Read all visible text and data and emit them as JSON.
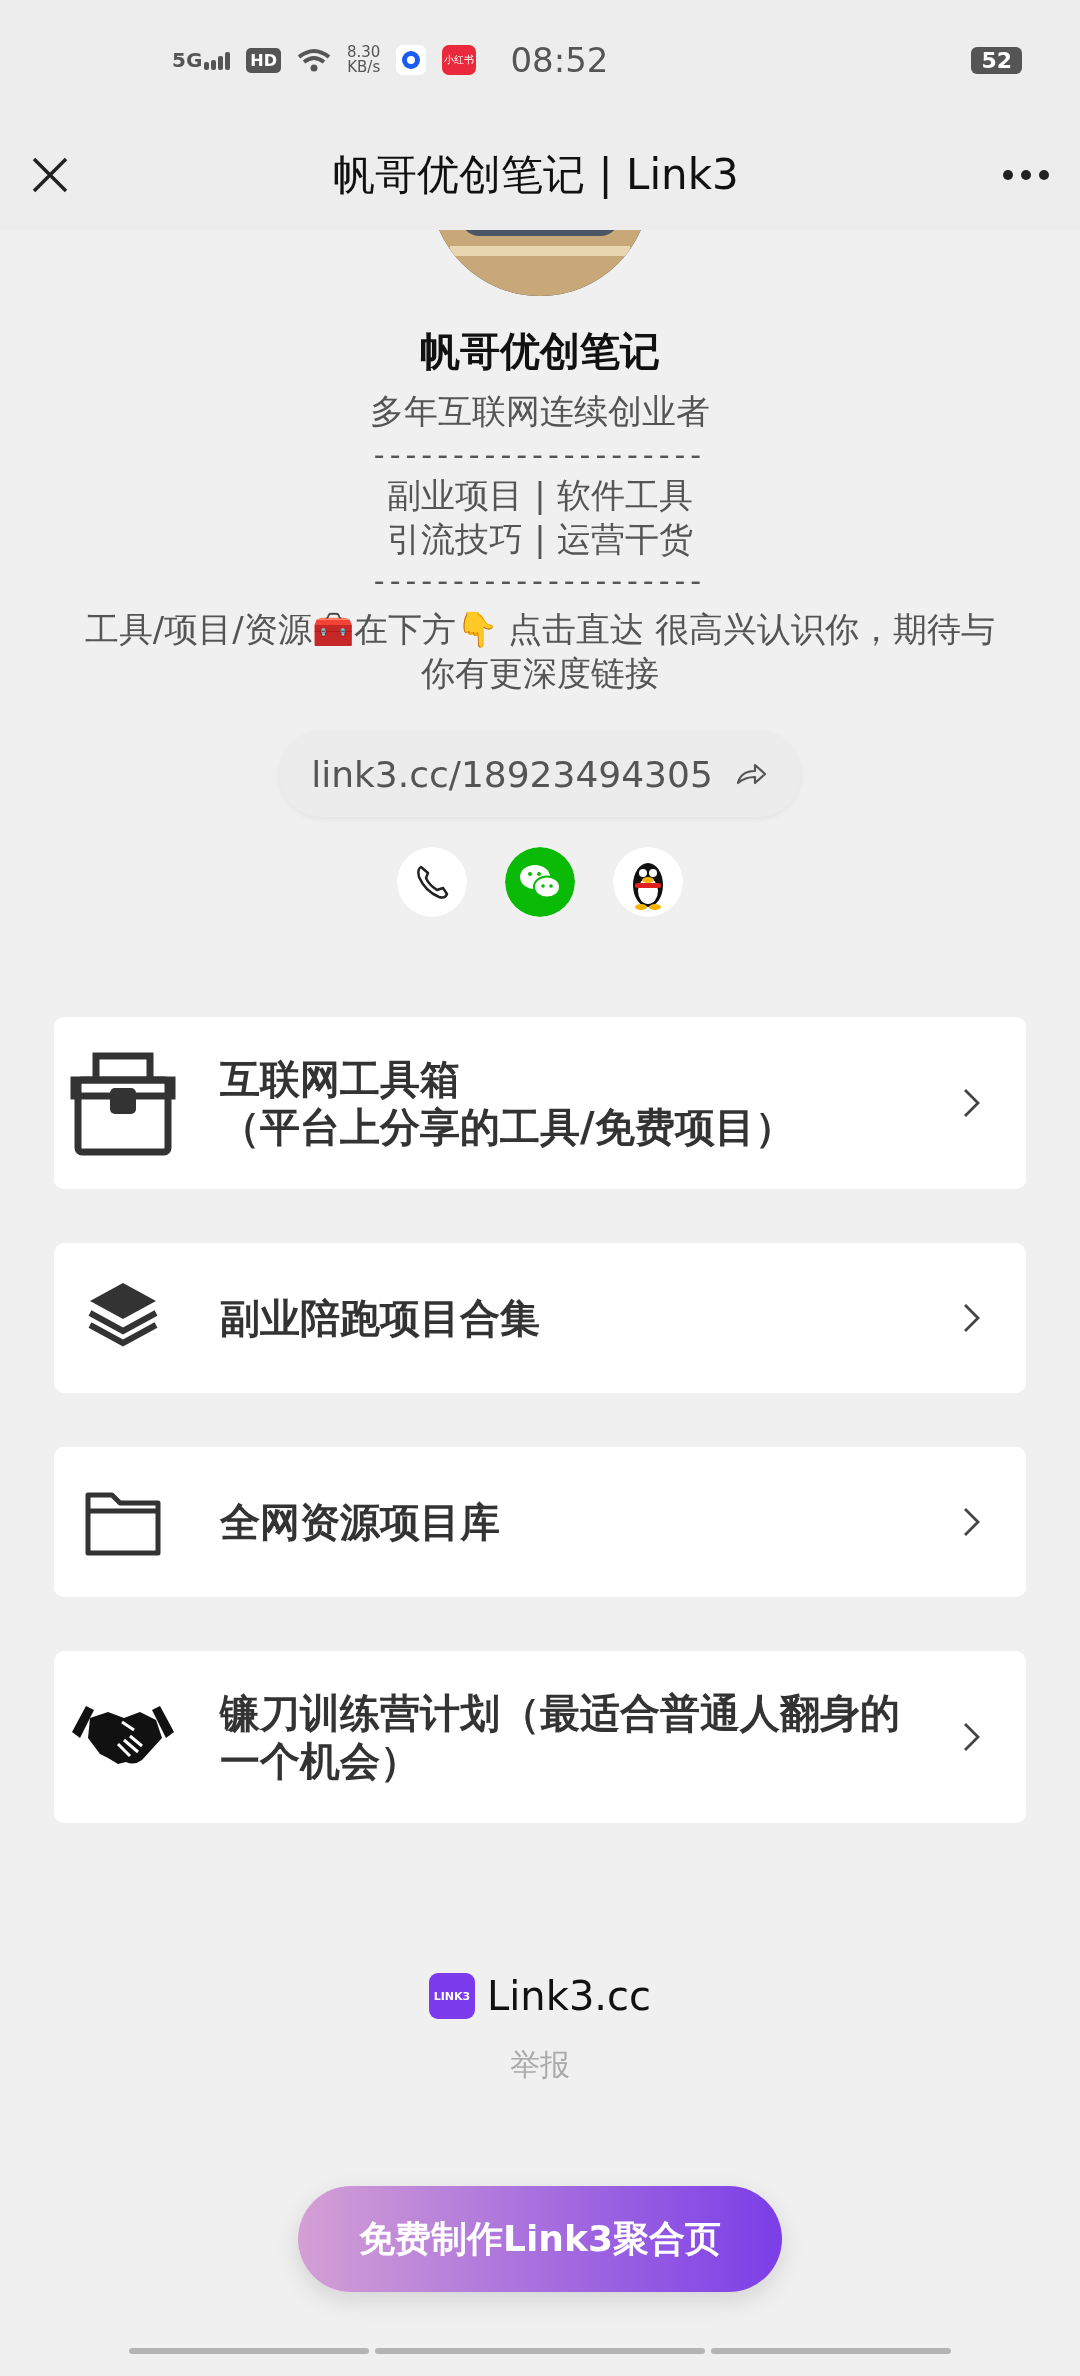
{
  "status_bar": {
    "network": "5G",
    "hd": "HD",
    "speed": "8.30",
    "speed_unit": "KB/s",
    "app_badge": "小红书",
    "time": "08:52",
    "battery": "52"
  },
  "nav": {
    "title": "帆哥优创笔记 | Link3"
  },
  "profile": {
    "avatar": {
      "kind": "picture"
    },
    "name": "帆哥优创笔记",
    "tagline": "多年互联网连续创业者",
    "divider_1": "---------------------",
    "tags": [
      "副业项目 | 软件工具",
      "引流技巧 | 运营干货"
    ],
    "divider_2": "---------------------",
    "intro": "工具/项目/资源🧰在下方👇 点击直达 很高兴认识你，期待与你有更深度链接",
    "link": "link3.cc/18923494305",
    "contacts": [
      {
        "kind": "phone"
      },
      {
        "kind": "wechat"
      },
      {
        "kind": "qq"
      }
    ]
  },
  "links": [
    {
      "kind": "toolbox",
      "title": "互联网工具箱",
      "subtitle": "（平台上分享的工具/免费项目）"
    },
    {
      "kind": "layers",
      "title": "副业陪跑项目合集"
    },
    {
      "kind": "folder",
      "title": "全网资源项目库"
    },
    {
      "kind": "handshake",
      "title": "镰刀训练营计划（最适合普通人翻身的一个机会）"
    }
  ],
  "footer": {
    "brand_badge": "LINK3",
    "brand": "Link3.cc",
    "report": "举报",
    "cta": "免费制作Link3聚合页"
  }
}
